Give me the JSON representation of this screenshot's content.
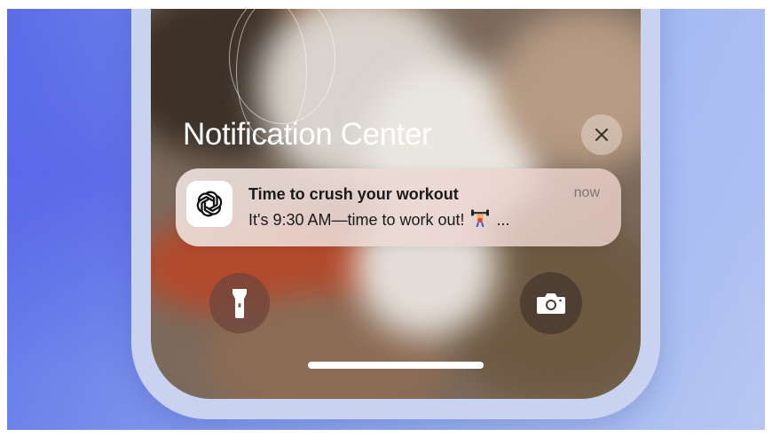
{
  "screen": {
    "header": {
      "title": "Notification Center"
    },
    "close_button": {
      "icon": "close-icon"
    },
    "notification": {
      "app_icon": "openai-logo-icon",
      "title": "Time to crush your workout",
      "time": "now",
      "body": "It's 9:30 AM—time to work out!",
      "emoji": "weightlifter-emoji-icon",
      "ellipsis": "..."
    },
    "quick_actions": {
      "left": {
        "icon": "flashlight-icon"
      },
      "right": {
        "icon": "camera-icon"
      }
    },
    "home_indicator": true
  },
  "colors": {
    "background_left": "#5b6fe8",
    "background_right": "#b9c8f2",
    "phone_frame": "#c9d3f0",
    "notification_bg": "#ebdcd7",
    "text_primary": "#1a1a1a",
    "text_secondary": "#7d7673"
  }
}
